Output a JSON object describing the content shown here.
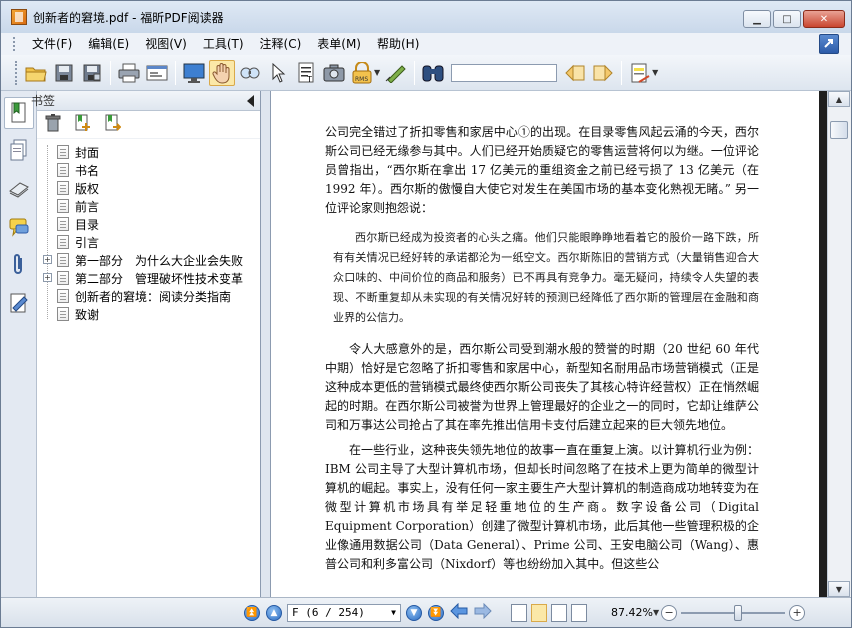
{
  "window": {
    "title": "创新者的窘境.pdf - 福昕PDF阅读器",
    "min_label": "▁",
    "max_label": "□",
    "close_label": "✕"
  },
  "menu": {
    "items": [
      "文件(F)",
      "编辑(E)",
      "视图(V)",
      "工具(T)",
      "注释(C)",
      "表单(M)",
      "帮助(H)"
    ]
  },
  "toolbar": {
    "search_value": "",
    "icons": [
      "open-folder-icon",
      "save-icon",
      "save-as-icon",
      "print-icon",
      "properties-icon",
      "fullscreen-icon",
      "hand-tool-icon",
      "zoom-tool-icon",
      "select-arrow-icon",
      "text-select-icon",
      "snapshot-icon",
      "rms-lock-icon",
      "sign-icon",
      "binoculars-icon",
      "find-prev-icon",
      "find-next-icon",
      "highlight-icon"
    ],
    "rms_label": "RMS"
  },
  "bookmarks": {
    "header": "书签",
    "items": [
      {
        "label": "封面",
        "expandable": false
      },
      {
        "label": "书名",
        "expandable": false
      },
      {
        "label": "版权",
        "expandable": false
      },
      {
        "label": "前言",
        "expandable": false
      },
      {
        "label": "目录",
        "expandable": false
      },
      {
        "label": "引言",
        "expandable": false
      },
      {
        "label": "第一部分　为什么大企业会失败",
        "expandable": true
      },
      {
        "label": "第二部分　管理破坏性技术变革",
        "expandable": true
      },
      {
        "label": "创新者的窘境：阅读分类指南",
        "expandable": false
      },
      {
        "label": "致谢",
        "expandable": false
      }
    ]
  },
  "document": {
    "p1": "公司完全错过了折扣零售和家居中心①的出现。在目录零售风起云涌的今天，西尔斯公司已经无缘参与其中。人们已经开始质疑它的零售运营将何以为继。一位评论员曾指出，“西尔斯在拿出 17 亿美元的重组资金之前已经亏损了 13 亿美元（在 1992 年）。西尔斯的傲慢自大使它对发生在美国市场的基本变化熟视无睹。” 另一位评论家则抱怨说：",
    "quote": "西尔斯已经成为投资者的心头之痛。他们只能眼睁睁地看着它的股价一路下跌，所有有关情况已经好转的承诺都沦为一纸空文。西尔斯陈旧的营销方式（大量销售迎合大众口味的、中间价位的商品和服务）已不再具有竞争力。毫无疑问，持续令人失望的表现、不断重复却从未实现的有关情况好转的预测已经降低了西尔斯的管理层在金融和商业界的公信力。",
    "p2": "令人大感意外的是，西尔斯公司受到潮水般的赞誉的时期（20 世纪 60 年代中期）恰好是它忽略了折扣零售和家居中心，新型知名耐用品市场营销模式（正是这种成本更低的营销模式最终使西尔斯公司丧失了其核心特许经营权）正在悄然崛起的时期。在西尔斯公司被誉为世界上管理最好的企业之一的同时，它却让维萨公司和万事达公司抢占了其在率先推出信用卡支付后建立起来的巨大领先地位。",
    "p3": "在一些行业，这种丧失领先地位的故事一直在重复上演。以计算机行业为例：IBM 公司主导了大型计算机市场，但却长时间忽略了在技术上更为简单的微型计算机的崛起。事实上，没有任何一家主要生产大型计算机的制造商成功地转变为在微型计算机市场具有举足轻重地位的生产商。数字设备公司（Digital Equipment Corporation）创建了微型计算机市场，此后其他一些管理积极的企业像通用数据公司（Data General）、Prime 公司、王安电脑公司（Wang）、惠普公司和利多富公司（Nixdorf）等也纷纷加入其中。但这些公"
  },
  "statusbar": {
    "page_field": "F (6 / 254)",
    "zoom": "87.42%",
    "zoom_level": 0.55
  }
}
